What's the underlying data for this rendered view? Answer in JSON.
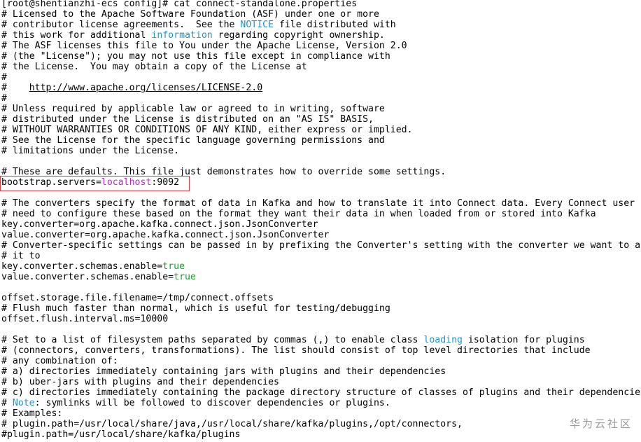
{
  "terminal": {
    "watermark": "华为云社区",
    "lines": [
      [
        {
          "t": "[root@shentianzhi-ecs config]# cat connect-standalone.properties"
        }
      ],
      [
        {
          "t": "# Licensed to the Apache Software Foundation (ASF) under one or more"
        }
      ],
      [
        {
          "t": "# contributor license agreements.  See the "
        },
        {
          "t": "NOTICE",
          "c": "cyan"
        },
        {
          "t": " file distributed with"
        }
      ],
      [
        {
          "t": "# this work for additional "
        },
        {
          "t": "information",
          "c": "cyan"
        },
        {
          "t": " regarding copyright ownership."
        }
      ],
      [
        {
          "t": "# The ASF licenses this file to You under the Apache License, Version 2.0"
        }
      ],
      [
        {
          "t": "# (the \"License\"); you may not use this file except in compliance with"
        }
      ],
      [
        {
          "t": "# the License.  You may obtain a copy of the License at"
        }
      ],
      [
        {
          "t": "#"
        }
      ],
      [
        {
          "t": "#    "
        },
        {
          "t": "http://www.apache.org/licenses/LICENSE-2.0",
          "u": true
        }
      ],
      [
        {
          "t": "#"
        }
      ],
      [
        {
          "t": "# Unless required by applicable law or agreed to in writing, software"
        }
      ],
      [
        {
          "t": "# distributed under the License is distributed on an \"AS IS\" BASIS,"
        }
      ],
      [
        {
          "t": "# WITHOUT WARRANTIES OR CONDITIONS OF ANY KIND, either express or implied."
        }
      ],
      [
        {
          "t": "# See the License for the specific language governing permissions and"
        }
      ],
      [
        {
          "t": "# limitations under the License."
        }
      ],
      [
        {
          "t": ""
        }
      ],
      [
        {
          "t": "# These are defaults. This file just demonstrates how to override some settings."
        }
      ],
      [
        {
          "t": "bootstrap.servers="
        },
        {
          "t": "localhost",
          "c": "magenta"
        },
        {
          "t": ":9092"
        }
      ],
      [
        {
          "t": ""
        }
      ],
      [
        {
          "t": "# The converters specify the format of data in Kafka and how to translate it into Connect data. Every Connect user"
        }
      ],
      [
        {
          "t": "# need to configure these based on the format they want their data in when loaded from or stored into Kafka"
        }
      ],
      [
        {
          "t": "key.converter=org.apache.kafka.connect.json.JsonConverter"
        }
      ],
      [
        {
          "t": "value.converter=org.apache.kafka.connect.json.JsonConverter"
        }
      ],
      [
        {
          "t": "# Converter-specific settings can be passed in by prefixing the Converter's setting with the converter we want to a"
        }
      ],
      [
        {
          "t": "# it to"
        }
      ],
      [
        {
          "t": "key.converter.schemas.enable="
        },
        {
          "t": "true",
          "c": "green"
        }
      ],
      [
        {
          "t": "value.converter.schemas.enable="
        },
        {
          "t": "true",
          "c": "green"
        }
      ],
      [
        {
          "t": ""
        }
      ],
      [
        {
          "t": "offset.storage.file.filename=/tmp/connect.offsets"
        }
      ],
      [
        {
          "t": "# Flush much faster than normal, which is useful for testing/debugging"
        }
      ],
      [
        {
          "t": "offset.flush.interval.ms=10000"
        }
      ],
      [
        {
          "t": ""
        }
      ],
      [
        {
          "t": "# Set to a list of filesystem paths separated by commas (,) to enable class "
        },
        {
          "t": "loading",
          "c": "cyan"
        },
        {
          "t": " isolation for plugins"
        }
      ],
      [
        {
          "t": "# (connectors, converters, transformations). The list should consist of top level directories that include"
        }
      ],
      [
        {
          "t": "# any combination of:"
        }
      ],
      [
        {
          "t": "# a) directories immediately containing jars with plugins and their dependencies"
        }
      ],
      [
        {
          "t": "# b) uber-jars with plugins and their dependencies"
        }
      ],
      [
        {
          "t": "# c) directories immediately containing the package directory structure of classes of plugins and their dependencie"
        }
      ],
      [
        {
          "t": "# "
        },
        {
          "t": "Note",
          "c": "cyan"
        },
        {
          "t": ": symlinks will be followed to discover dependencies or plugins."
        }
      ],
      [
        {
          "t": "# Examples:"
        }
      ],
      [
        {
          "t": "# plugin.path=/usr/local/share/java,/usr/local/share/kafka/plugins,/opt/connectors,"
        }
      ],
      [
        {
          "t": "#plugin.path=/usr/local/share/kafka/plugins"
        }
      ]
    ],
    "colors": {
      "cyan": "#1c95d6",
      "magenta": "#b42ec6",
      "green": "#16a32a",
      "highlight_box": "#e0383e"
    }
  }
}
